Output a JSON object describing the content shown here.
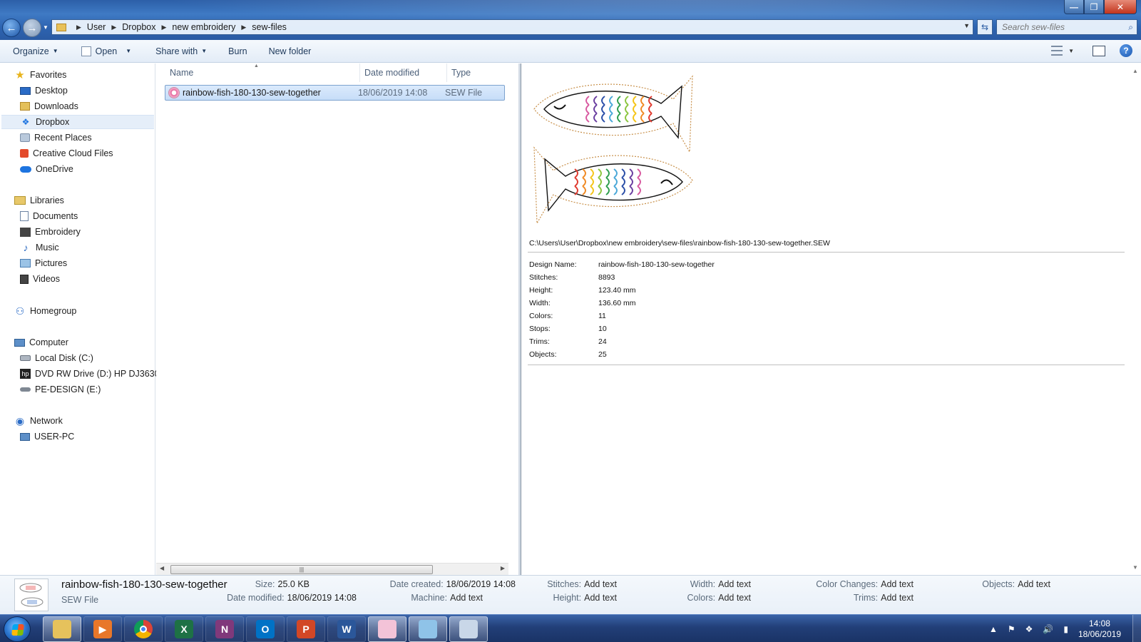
{
  "window": {
    "controls": {
      "minimize": "—",
      "maximize": "❐",
      "close": "✕"
    }
  },
  "address_bar": {
    "crumbs": [
      "User",
      "Dropbox",
      "new embroidery",
      "sew-files"
    ],
    "search_placeholder": "Search sew-files"
  },
  "commands": {
    "organize": "Organize",
    "open": "Open",
    "share_with": "Share with",
    "burn": "Burn",
    "new_folder": "New folder"
  },
  "nav": {
    "favorites_header": "Favorites",
    "favorites": [
      "Desktop",
      "Downloads",
      "Dropbox",
      "Recent Places",
      "Creative Cloud Files",
      "OneDrive"
    ],
    "libraries_header": "Libraries",
    "libraries": [
      "Documents",
      "Embroidery",
      "Music",
      "Pictures",
      "Videos"
    ],
    "homegroup": "Homegroup",
    "computer_header": "Computer",
    "computer": [
      "Local Disk (C:)",
      "DVD RW Drive (D:) HP DJ3630",
      "PE-DESIGN (E:)"
    ],
    "network_header": "Network",
    "network": [
      "USER-PC"
    ],
    "selected": "Dropbox"
  },
  "file_list": {
    "columns": [
      "Name",
      "Date modified",
      "Type"
    ],
    "files": [
      {
        "name": "rainbow-fish-180-130-sew-together",
        "date": "18/06/2019 14:08",
        "type": "SEW File"
      }
    ]
  },
  "preview": {
    "path": "C:\\Users\\User\\Dropbox\\new embroidery\\sew-files\\rainbow-fish-180-130-sew-together.SEW",
    "properties": [
      {
        "key": "Design Name:",
        "value": "rainbow-fish-180-130-sew-together"
      },
      {
        "key": "Stitches:",
        "value": "8893"
      },
      {
        "key": "Height:",
        "value": "123.40 mm"
      },
      {
        "key": "Width:",
        "value": "136.60 mm"
      },
      {
        "key": "Colors:",
        "value": "11"
      },
      {
        "key": "Stops:",
        "value": "10"
      },
      {
        "key": "Trims:",
        "value": "24"
      },
      {
        "key": "Objects:",
        "value": "25"
      }
    ],
    "scale_colors": [
      "#e03a2f",
      "#f08a24",
      "#f5c518",
      "#8cc63f",
      "#2e9e4f",
      "#4aa8d8",
      "#2b4fa8",
      "#6a3fa0",
      "#d85aa0"
    ]
  },
  "details": {
    "name": "rainbow-fish-180-130-sew-together",
    "type": "SEW File",
    "size_label": "Size:",
    "size": "25.0 KB",
    "date_modified_label": "Date modified:",
    "date_modified": "18/06/2019 14:08",
    "date_created_label": "Date created:",
    "date_created": "18/06/2019 14:08",
    "machine_label": "Machine:",
    "machine": "Add text",
    "stitches_label": "Stitches:",
    "stitches": "Add text",
    "height_label": "Height:",
    "height": "Add text",
    "width_label": "Width:",
    "width": "Add text",
    "colors_label": "Colors:",
    "colors": "Add text",
    "color_changes_label": "Color Changes:",
    "color_changes": "Add text",
    "trims_label": "Trims:",
    "trims": "Add text",
    "objects_label": "Objects:",
    "objects": "Add text"
  },
  "taskbar": {
    "apps": [
      {
        "name": "explorer",
        "letter": "",
        "color": "#e6c25c",
        "active": true
      },
      {
        "name": "media-player",
        "letter": "▶",
        "color": "#e8772a",
        "active": false
      },
      {
        "name": "chrome",
        "letter": "",
        "color": "#dd4b39",
        "active": false
      },
      {
        "name": "excel",
        "letter": "X",
        "color": "#1e7145",
        "active": false
      },
      {
        "name": "onenote",
        "letter": "N",
        "color": "#80397b",
        "active": false
      },
      {
        "name": "outlook",
        "letter": "O",
        "color": "#0072c6",
        "active": false
      },
      {
        "name": "powerpoint",
        "letter": "P",
        "color": "#d24726",
        "active": false
      },
      {
        "name": "word",
        "letter": "W",
        "color": "#2b579a",
        "active": false
      },
      {
        "name": "embroidery-app",
        "letter": "",
        "color": "#f3c3d8",
        "active": true
      },
      {
        "name": "notepad",
        "letter": "",
        "color": "#8fc3e8",
        "active": true
      },
      {
        "name": "paint",
        "letter": "",
        "color": "#c9d7e8",
        "active": true
      }
    ],
    "time": "14:08",
    "date": "18/06/2019"
  }
}
